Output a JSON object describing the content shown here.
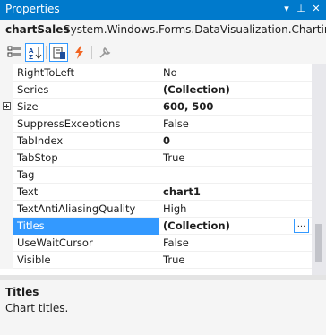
{
  "window": {
    "title": "Properties",
    "pin_icon": "pin-icon",
    "close_icon": "close-icon",
    "dropdown_glyph": "▾",
    "pin_glyph": "⊥",
    "close_glyph": "✕"
  },
  "object_selector": {
    "name": "chartSales",
    "type": "System.Windows.Forms.DataVisualization.Charting.C"
  },
  "toolbar": {
    "buttons": [
      {
        "icon": "categorized-icon",
        "active": false
      },
      {
        "icon": "alphabetical-icon",
        "active": true
      },
      {
        "icon": "properties-icon",
        "active": false
      },
      {
        "icon": "events-icon",
        "active": false
      },
      {
        "icon": "property-pages-icon",
        "active": false
      }
    ]
  },
  "properties": [
    {
      "name": "RightToLeft",
      "value": "No",
      "bold": false
    },
    {
      "name": "Series",
      "value": "(Collection)",
      "bold": true
    },
    {
      "name": "Size",
      "value": "600, 500",
      "bold": true,
      "expandable": true
    },
    {
      "name": "SuppressExceptions",
      "value": "False",
      "bold": false
    },
    {
      "name": "TabIndex",
      "value": "0",
      "bold": true
    },
    {
      "name": "TabStop",
      "value": "True",
      "bold": false
    },
    {
      "name": "Tag",
      "value": "",
      "bold": false
    },
    {
      "name": "Text",
      "value": "chart1",
      "bold": true
    },
    {
      "name": "TextAntiAliasingQuality",
      "value": "High",
      "bold": false
    },
    {
      "name": "Titles",
      "value": "(Collection)",
      "bold": true,
      "selected": true,
      "ellipsis": "..."
    },
    {
      "name": "UseWaitCursor",
      "value": "False",
      "bold": false
    },
    {
      "name": "Visible",
      "value": "True",
      "bold": false
    }
  ],
  "description": {
    "title": "Titles",
    "text": "Chart titles."
  },
  "colors": {
    "accent": "#007acc",
    "selection": "#3399ff",
    "events_icon": "#f26522"
  }
}
